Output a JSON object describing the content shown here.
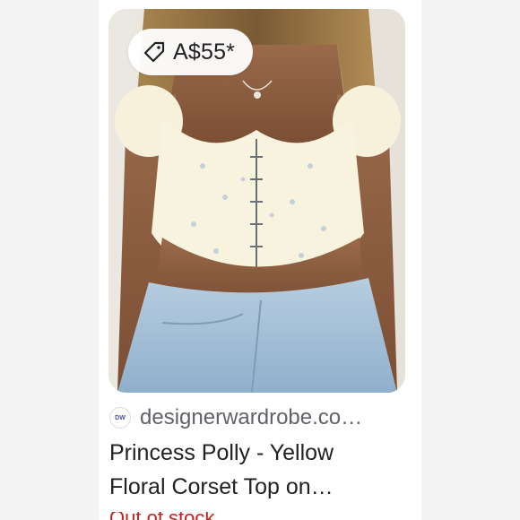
{
  "result_card": {
    "price_label": "A$55*",
    "price_icon": "tag-icon",
    "source": {
      "favicon_text": "DW",
      "domain_text": "designerwardrobe.co…"
    },
    "title_lines": [
      "Princess Polly - Yellow",
      "Floral Corset Top on…"
    ],
    "accent_color": "#c5221f"
  }
}
